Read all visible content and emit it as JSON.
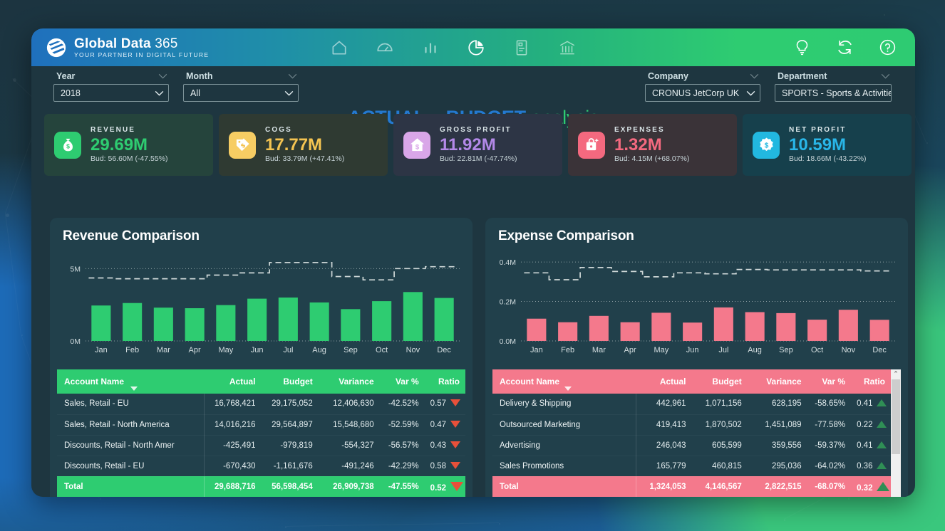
{
  "brand": {
    "name_bold": "Global Data",
    "name_light": " 365",
    "tagline": "YOUR PARTNER IN DIGITAL FUTURE"
  },
  "nav": {
    "items": [
      {
        "name": "home-icon",
        "label": "Home",
        "active": false
      },
      {
        "name": "gauge-icon",
        "label": "Dashboard",
        "active": false
      },
      {
        "name": "bar-chart-icon",
        "label": "Charts",
        "active": false
      },
      {
        "name": "pie-chart-icon",
        "label": "Analysis",
        "active": true
      },
      {
        "name": "document-icon",
        "label": "Reports",
        "active": false
      },
      {
        "name": "bank-icon",
        "label": "Finance",
        "active": false
      }
    ],
    "right_items": [
      {
        "name": "lightbulb-icon",
        "label": "Insights"
      },
      {
        "name": "refresh-icon",
        "label": "Refresh"
      },
      {
        "name": "help-icon",
        "label": "Help"
      }
    ]
  },
  "title": {
    "bold_part": "ACTUAL v BUDGET",
    "light_part": "analysis"
  },
  "filters": [
    {
      "id": "year",
      "label": "Year",
      "value": "2018"
    },
    {
      "id": "month",
      "label": "Month",
      "value": "All"
    },
    {
      "id": "comp",
      "label": "Company",
      "value": "CRONUS JetCorp UK"
    },
    {
      "id": "dept",
      "label": "Department",
      "value": "SPORTS - Sports & Activities"
    }
  ],
  "kpis": [
    {
      "title": "REVENUE",
      "value": "29.69M",
      "sub": "Bud: 56.60M (-47.55%)",
      "icon": "money-bag-icon",
      "value_color": "#2ecc71",
      "icon_bg": "#2ecc71",
      "card_bg": "#25443c"
    },
    {
      "title": "COGS",
      "value": "17.77M",
      "sub": "Bud: 33.79M (+47.41%)",
      "icon": "price-tag-icon",
      "value_color": "#f5c451",
      "icon_bg": "#f7cd63",
      "card_bg": "#2f3a32"
    },
    {
      "title": "GROSS PROFIT",
      "value": "11.92M",
      "sub": "Bud: 22.81M (-47.74%)",
      "icon": "house-dollar-icon",
      "value_color": "#b389e8",
      "icon_bg": "#d9a6e8",
      "card_bg": "#2d3545"
    },
    {
      "title": "EXPENSES",
      "value": "1.32M",
      "sub": "Bud: 4.15M (+68.07%)",
      "icon": "expense-bag-icon",
      "value_color": "#f4697f",
      "icon_bg": "#f4697f",
      "card_bg": "#3a3338"
    },
    {
      "title": "NET PROFIT",
      "value": "10.59M",
      "sub": "Bud: 18.66M (-43.22%)",
      "icon": "badge-dollar-icon",
      "value_color": "#29b6e8",
      "icon_bg": "#22b8e0",
      "card_bg": "#16404c"
    }
  ],
  "panels": {
    "revenue": {
      "title": "Revenue Comparison"
    },
    "expense": {
      "title": "Expense Comparison"
    }
  },
  "chart_data": [
    {
      "type": "bar",
      "id": "revenue-comparison",
      "title": "Revenue Comparison",
      "categories": [
        "Jan",
        "Feb",
        "Mar",
        "Apr",
        "May",
        "Jun",
        "Jul",
        "Aug",
        "Sep",
        "Oct",
        "Nov",
        "Dec"
      ],
      "series": [
        {
          "name": "Actual",
          "type": "bar",
          "color": "#2ecc71",
          "values": [
            2.45,
            2.62,
            2.3,
            2.26,
            2.48,
            2.92,
            3.0,
            2.66,
            2.2,
            2.75,
            3.38,
            2.97
          ]
        },
        {
          "name": "Budget",
          "type": "step",
          "color": "#cfd8d8",
          "style": "dashed",
          "values": [
            4.35,
            4.3,
            4.3,
            4.3,
            4.55,
            4.7,
            5.42,
            5.42,
            4.45,
            4.22,
            5.0,
            5.13
          ]
        }
      ],
      "ylabel": "",
      "xlabel": "",
      "yticks": [
        0,
        5
      ],
      "ytick_labels": [
        "0M",
        "5M"
      ],
      "ylim": [
        0,
        6
      ],
      "grid": true,
      "legend": false,
      "units": "Millions"
    },
    {
      "type": "bar",
      "id": "expense-comparison",
      "title": "Expense Comparison",
      "categories": [
        "Jan",
        "Feb",
        "Mar",
        "Apr",
        "May",
        "Jun",
        "Jul",
        "Aug",
        "Sep",
        "Oct",
        "Nov",
        "Dec"
      ],
      "series": [
        {
          "name": "Actual",
          "type": "bar",
          "color": "#f4798c",
          "values": [
            0.113,
            0.095,
            0.127,
            0.095,
            0.143,
            0.093,
            0.17,
            0.146,
            0.141,
            0.108,
            0.158,
            0.107
          ]
        },
        {
          "name": "Budget",
          "type": "step",
          "color": "#cfd8d8",
          "style": "dashed",
          "values": [
            0.345,
            0.31,
            0.372,
            0.352,
            0.325,
            0.345,
            0.34,
            0.362,
            0.36,
            0.36,
            0.36,
            0.355
          ]
        }
      ],
      "ylabel": "",
      "xlabel": "",
      "yticks": [
        0,
        0.2,
        0.4
      ],
      "ytick_labels": [
        "0.0M",
        "0.2M",
        "0.4M"
      ],
      "ylim": [
        0,
        0.44
      ],
      "grid": true,
      "legend": false,
      "units": "Millions"
    }
  ],
  "revenue_table": {
    "accent": "#2ecc71",
    "columns": [
      "Account Name",
      "Actual",
      "Budget",
      "Variance",
      "Var %",
      "Ratio"
    ],
    "rows": [
      {
        "account": "Sales, Retail - EU",
        "actual": "16,768,421",
        "budget": "29,175,052",
        "variance": "12,406,630",
        "var_pct": "-42.52%",
        "ratio": "0.57",
        "trend": "down"
      },
      {
        "account": "Sales, Retail - North America",
        "actual": "14,016,216",
        "budget": "29,564,897",
        "variance": "15,548,680",
        "var_pct": "-52.59%",
        "ratio": "0.47",
        "trend": "down"
      },
      {
        "account": "Discounts, Retail - North Amer",
        "actual": "-425,491",
        "budget": "-979,819",
        "variance": "-554,327",
        "var_pct": "-56.57%",
        "ratio": "0.43",
        "trend": "down"
      },
      {
        "account": "Discounts, Retail - EU",
        "actual": "-670,430",
        "budget": "-1,161,676",
        "variance": "-491,246",
        "var_pct": "-42.29%",
        "ratio": "0.58",
        "trend": "down"
      }
    ],
    "total": {
      "account": "Total",
      "actual": "29,688,716",
      "budget": "56,598,454",
      "variance": "26,909,738",
      "var_pct": "-47.55%",
      "ratio": "0.52",
      "trend": "down"
    }
  },
  "expense_table": {
    "accent": "#f4798c",
    "columns": [
      "Account Name",
      "Actual",
      "Budget",
      "Variance",
      "Var %",
      "Ratio"
    ],
    "rows": [
      {
        "account": "Delivery & Shipping",
        "actual": "442,961",
        "budget": "1,071,156",
        "variance": "628,195",
        "var_pct": "-58.65%",
        "ratio": "0.41",
        "trend": "up"
      },
      {
        "account": "Outsourced Marketing",
        "actual": "419,413",
        "budget": "1,870,502",
        "variance": "1,451,089",
        "var_pct": "-77.58%",
        "ratio": "0.22",
        "trend": "up"
      },
      {
        "account": "Advertising",
        "actual": "246,043",
        "budget": "605,599",
        "variance": "359,556",
        "var_pct": "-59.37%",
        "ratio": "0.41",
        "trend": "up"
      },
      {
        "account": "Sales Promotions",
        "actual": "165,779",
        "budget": "460,815",
        "variance": "295,036",
        "var_pct": "-64.02%",
        "ratio": "0.36",
        "trend": "up"
      }
    ],
    "total": {
      "account": "Total",
      "actual": "1,324,053",
      "budget": "4,146,567",
      "variance": "2,822,515",
      "var_pct": "-68.07%",
      "ratio": "0.32",
      "trend": "up"
    },
    "scrollbar": {
      "up": "⌃",
      "down": "⌄"
    }
  }
}
